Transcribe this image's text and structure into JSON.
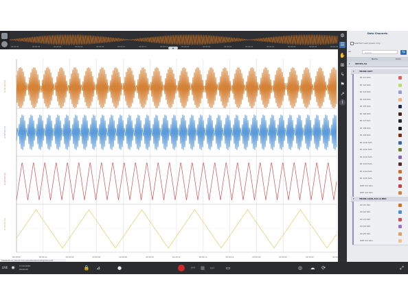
{
  "overview": {
    "ticks": [
      "00:00:00",
      "00:00:02",
      "00:00:04",
      "00:00:06",
      "00:00:08",
      "00:00:10",
      "00:00:12",
      "00:00:14",
      "00:00:16",
      "00:00:18",
      "00:00:20",
      "00:00:22",
      "00:00:24",
      "00:00:26",
      "00:00:28",
      "00:00:30"
    ]
  },
  "plot": {
    "y_labels": [
      "AI 1/1 Sim [V]",
      "AI 1/2 Sim [V]",
      "AI 1/3 Sim [V]",
      "AI 1/4 Sim [V]"
    ],
    "x_ticks": [
      "00:26:00",
      "00:26:02",
      "00:26:04",
      "00:26:06",
      "00:26:08",
      "00:26:10",
      "00:26:12",
      "00:26:14",
      "00:26:16",
      "00:26:18",
      "00:26:20",
      "00:26:22",
      "00:26:24"
    ],
    "colors": {
      "ch1": "#d07420",
      "ch2": "#4a90d6",
      "ch3": "#d05050",
      "ch4": "#d8d060",
      "grid": "#d0d0d0"
    }
  },
  "panel": {
    "title": "Data Channels",
    "show_used_only": "Selected used power only",
    "all_label": "All",
    "search_placeholder": "Search...",
    "header_name": "Name",
    "header_color": "Color",
    "device": "SIRIUS-AA",
    "groups": [
      {
        "name": "TRION-5AIT",
        "channels": [
          {
            "label": "DI 1/1 Sim",
            "color": "#e06060"
          },
          {
            "label": "DI 1/2 Sim",
            "color": "#b8e06a"
          },
          {
            "label": "DI 1/3 Sim",
            "color": "#9a9ad8"
          },
          {
            "label": "DI 1/4 Sim",
            "color": "#f0b080"
          },
          {
            "label": "DI 1/5 Sim",
            "color": "#1e2a4a"
          },
          {
            "label": "DI 1/6 Sim",
            "color": "#4a2418"
          },
          {
            "label": "DI 1/7 Sim",
            "color": "#2a2a2a"
          },
          {
            "label": "DI 1/8 Sim",
            "color": "#1a1a1a"
          },
          {
            "label": "DI 1/9 Sim",
            "color": "#7a3010"
          },
          {
            "label": "DI 1/10 Sim",
            "color": "#3a66a8"
          },
          {
            "label": "DI 1/11 Sim",
            "color": "#708030"
          },
          {
            "label": "DI 1/12 Sim",
            "color": "#8a64b0"
          },
          {
            "label": "DI 1/13 Sim",
            "color": "#5a2a2a"
          },
          {
            "label": "DI 1/14 Sim",
            "color": "#d07030"
          },
          {
            "label": "DI 1/15 Sim",
            "color": "#c05050"
          },
          {
            "label": "CNT 1/1 Sim",
            "color": "#d04040"
          },
          {
            "label": "CNT 1/2 Sim",
            "color": "#d08040"
          }
        ]
      },
      {
        "name": "TRION-1620-ACC-6-BNC",
        "channels": [
          {
            "label": "AI 1/1 Sim",
            "color": "#d07420"
          },
          {
            "label": "AI 1/2 Sim",
            "color": "#4a90d6"
          },
          {
            "label": "AI 1/3 Sim",
            "color": "#d05050"
          },
          {
            "label": "AI 1/4 Sim",
            "color": "#a070c0"
          },
          {
            "label": "AI 1/5 Sim",
            "color": "#e0a060"
          },
          {
            "label": "CNT 1/1 Sim",
            "color": "#f0c090"
          }
        ]
      }
    ]
  },
  "status": {
    "path": "Installed/local_store/1.0.2/c.auto/stored/recording/time.xd.tt",
    "live_label": "LIVE",
    "date": "17.02.2019",
    "time": "00:26:00"
  }
}
